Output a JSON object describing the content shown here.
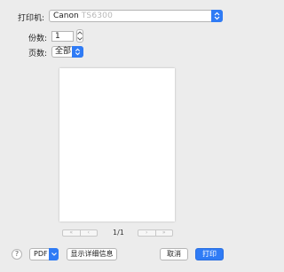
{
  "printer": {
    "label": "打印机:",
    "brand": "Canon",
    "model": "TS6300"
  },
  "copies": {
    "label": "份数:",
    "value": "1"
  },
  "pages": {
    "label": "页数:",
    "value": "全部"
  },
  "preview": {
    "page_counter": "1/1"
  },
  "bottom": {
    "help_label": "?",
    "pdf_label": "PDF",
    "show_details_label": "显示详细信息",
    "cancel_label": "取消",
    "print_label": "打印"
  },
  "colors": {
    "accent": "#2f7bf5",
    "background": "#ececec"
  }
}
